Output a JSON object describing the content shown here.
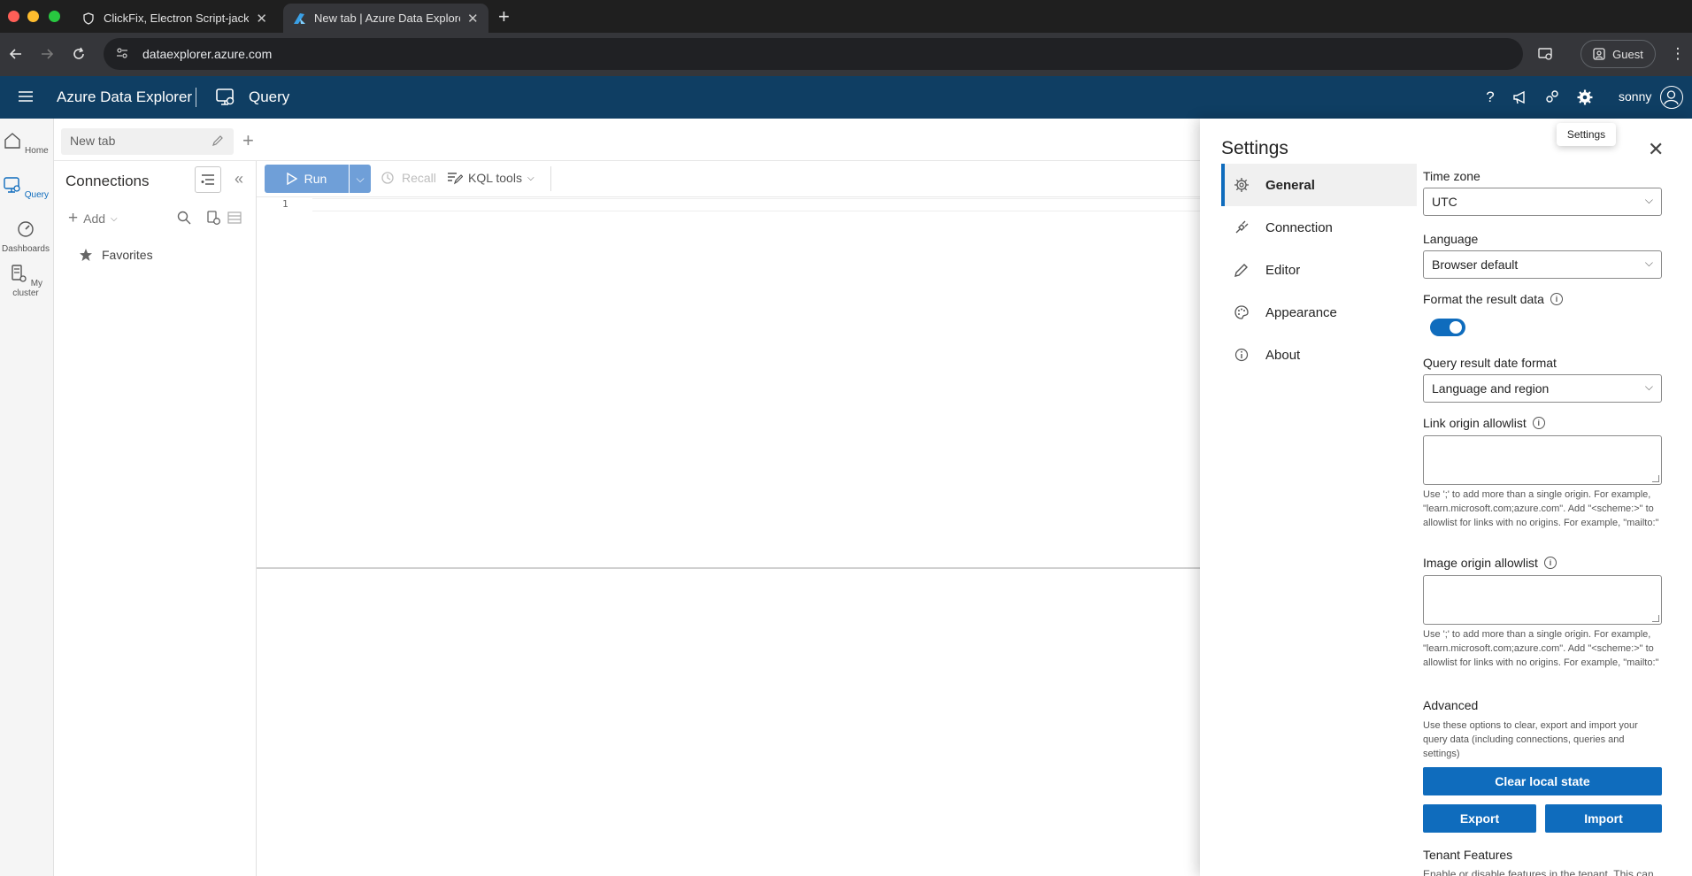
{
  "browser": {
    "tabs": [
      {
        "title": "ClickFix, Electron Script-jacking",
        "active": false
      },
      {
        "title": "New tab | Azure Data Explorer",
        "active": true
      }
    ],
    "url": "dataexplorer.azure.com",
    "profile_label": "Guest"
  },
  "app": {
    "brand": "Azure Data Explorer",
    "section": "Query",
    "user": "sonny",
    "settings_tooltip": "Settings"
  },
  "rail": {
    "items": [
      {
        "label": "Home",
        "icon": "home-icon"
      },
      {
        "label": "Query",
        "icon": "query-icon",
        "active": true
      },
      {
        "label": "Dashboards",
        "icon": "dashboard-icon"
      },
      {
        "label": "My cluster",
        "icon": "cluster-icon"
      }
    ]
  },
  "query_tab": {
    "label": "New tab"
  },
  "connections": {
    "title": "Connections",
    "add_label": "Add",
    "favorites_label": "Favorites"
  },
  "editor": {
    "run_label": "Run",
    "recall_label": "Recall",
    "kql_tools_label": "KQL tools",
    "line_number": "1"
  },
  "settings": {
    "title": "Settings",
    "nav": [
      {
        "label": "General",
        "icon": "gear-icon",
        "active": true
      },
      {
        "label": "Connection",
        "icon": "plug-icon"
      },
      {
        "label": "Editor",
        "icon": "pencil-icon"
      },
      {
        "label": "Appearance",
        "icon": "palette-icon"
      },
      {
        "label": "About",
        "icon": "info-icon"
      }
    ],
    "time_zone": {
      "label": "Time zone",
      "value": "UTC"
    },
    "language": {
      "label": "Language",
      "value": "Browser default"
    },
    "format_result": {
      "label": "Format the result data",
      "enabled": true
    },
    "date_format": {
      "label": "Query result date format",
      "value": "Language and region"
    },
    "link_allowlist": {
      "label": "Link origin allowlist",
      "value": "",
      "help": "Use ';' to add more than a single origin. For example, \"learn.microsoft.com;azure.com\". Add \"<scheme:>\" to allowlist for links with no origins. For example, \"mailto:\""
    },
    "image_allowlist": {
      "label": "Image origin allowlist",
      "value": "",
      "help": "Use ';' to add more than a single origin. For example, \"learn.microsoft.com;azure.com\". Add \"<scheme:>\" to allowlist for links with no origins. For example, \"mailto:\""
    },
    "advanced": {
      "title": "Advanced",
      "description": "Use these options to clear, export and import your query data (including connections, queries and settings)",
      "clear_label": "Clear local state",
      "export_label": "Export",
      "import_label": "Import"
    },
    "tenant": {
      "title": "Tenant Features",
      "description": "Enable or disable features in the tenant. This can"
    }
  },
  "colors": {
    "app_header": "#0f3e63",
    "accent": "#0f6cbd",
    "run_button": "#6f9fd8"
  }
}
